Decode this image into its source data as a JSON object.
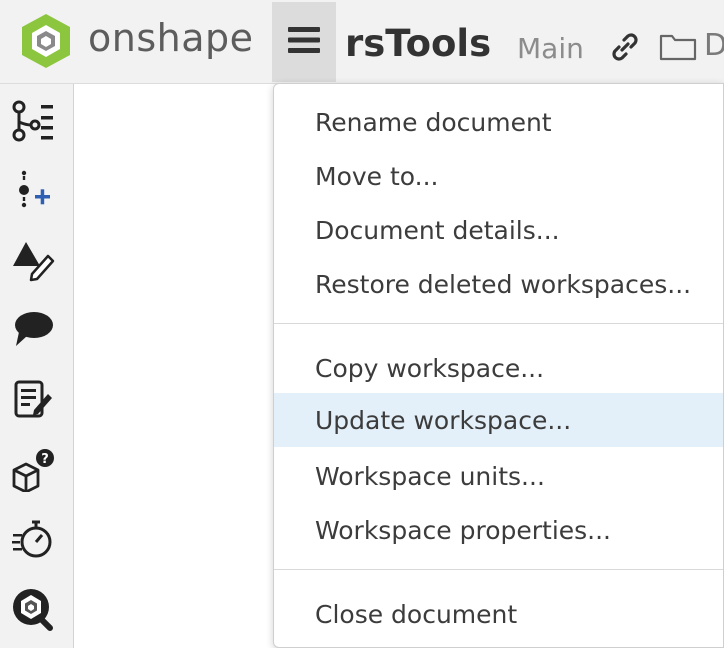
{
  "header": {
    "brand": "onshape",
    "document_name": "rsTools",
    "branch": "Main",
    "truncated_label": "D",
    "icons": {
      "logo": "onshape-logo-icon",
      "menu": "hamburger-menu-icon",
      "link": "link-icon",
      "folder": "folder-icon"
    }
  },
  "left_toolbar": {
    "icons": [
      "version-graph-icon",
      "insert-version-icon",
      "render-edit-icon",
      "comment-icon",
      "notes-edit-icon",
      "part-help-icon",
      "performance-timer-icon",
      "onshape-search-icon"
    ]
  },
  "document_menu": {
    "groups": [
      [
        "Rename document",
        "Move to...",
        "Document details...",
        "Restore deleted workspaces..."
      ],
      [
        "Copy workspace...",
        "Update workspace...",
        "Workspace units...",
        "Workspace properties..."
      ],
      [
        "Close document"
      ]
    ],
    "highlighted": "Update workspace..."
  },
  "colors": {
    "logo_green": "#8cc63f",
    "header_bg": "#f2f2f2",
    "highlight_bg": "#e3f0f9",
    "accent_blue": "#2f5fb3"
  }
}
